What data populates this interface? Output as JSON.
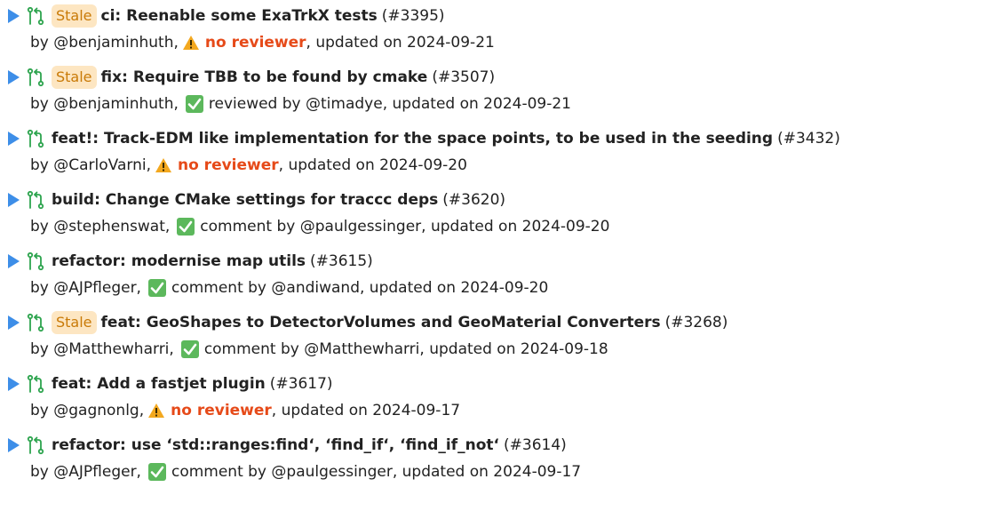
{
  "stale_label": "Stale",
  "colors": {
    "expander": "#3d8ee8",
    "stale_bg": "#fde6c2",
    "stale_text": "#c97a07",
    "no_reviewer": "#e64a19",
    "check_bg": "#5cb85c",
    "warn": "#f3a81f"
  },
  "icons": {
    "expander": "triangle-right-icon",
    "pr": "git-pull-request-icon",
    "warning": "warning-icon",
    "check": "check-mark-icon"
  },
  "pull_requests": [
    {
      "stale": true,
      "title": "ci: Reenable some ExaTrkX tests",
      "number": "(#3395)",
      "by": "by @benjaminhuth,",
      "review_icon": "warning",
      "review_text": "no reviewer",
      "review_user": "",
      "updated": ", updated on 2024-09-21"
    },
    {
      "stale": true,
      "title": "fix: Require TBB to be found by cmake",
      "number": "(#3507)",
      "by": "by @benjaminhuth,",
      "review_icon": "check",
      "review_text": "reviewed by",
      "review_user": "@timadye",
      "updated": ", updated on 2024-09-21"
    },
    {
      "stale": false,
      "title": "feat!: Track-EDM like implementation for the space points, to be used in the seeding",
      "number": "(#3432)",
      "by": "by @CarloVarni,",
      "review_icon": "warning",
      "review_text": "no reviewer",
      "review_user": "",
      "updated": ", updated on 2024-09-20"
    },
    {
      "stale": false,
      "title": "build: Change CMake settings for traccc deps",
      "number": "(#3620)",
      "by": "by @stephenswat,",
      "review_icon": "check",
      "review_text": "comment by",
      "review_user": "@paulgessinger",
      "updated": ", updated on 2024-09-20"
    },
    {
      "stale": false,
      "title": "refactor: modernise map utils",
      "number": "(#3615)",
      "by": "by @AJPfleger,",
      "review_icon": "check",
      "review_text": "comment by",
      "review_user": "@andiwand",
      "updated": ", updated on 2024-09-20"
    },
    {
      "stale": true,
      "title": "feat: GeoShapes to DetectorVolumes and GeoMaterial Converters",
      "number": "(#3268)",
      "by": "by @Matthewharri,",
      "review_icon": "check",
      "review_text": "comment by",
      "review_user": "@Matthewharri",
      "updated": ", updated on 2024-09-18"
    },
    {
      "stale": false,
      "title": "feat: Add a fastjet plugin",
      "number": "(#3617)",
      "by": "by @gagnonlg,",
      "review_icon": "warning",
      "review_text": "no reviewer",
      "review_user": "",
      "updated": ", updated on 2024-09-17"
    },
    {
      "stale": false,
      "title": "refactor: use ‘std::ranges:find‘, ‘find_if‘, ‘find_if_not‘",
      "number": "(#3614)",
      "by": "by @AJPfleger,",
      "review_icon": "check",
      "review_text": "comment by",
      "review_user": "@paulgessinger",
      "updated": ", updated on 2024-09-17"
    }
  ]
}
